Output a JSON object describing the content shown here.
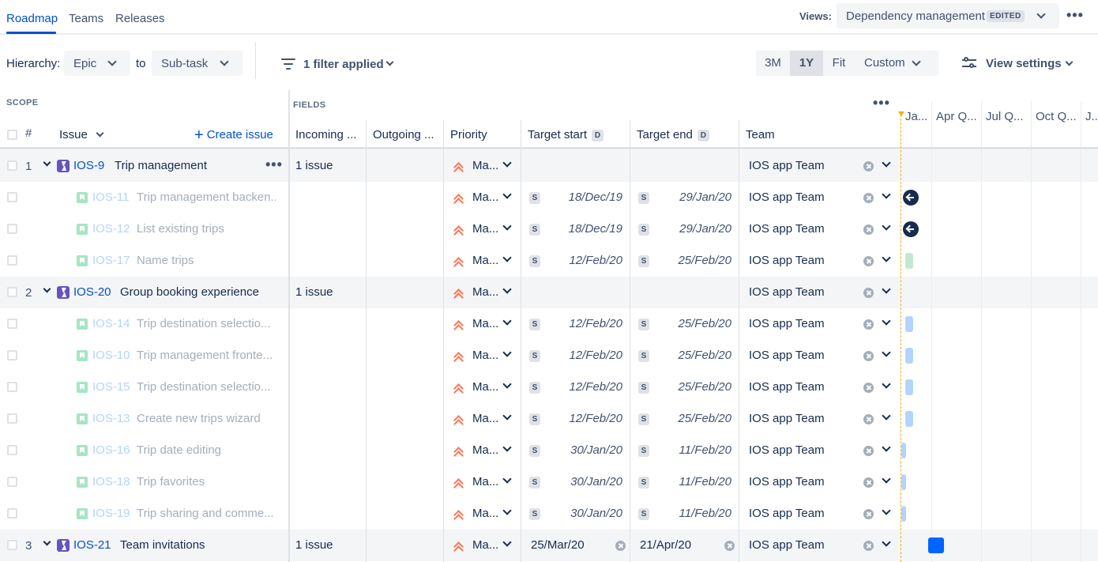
{
  "nav": {
    "tabs": [
      "Roadmap",
      "Teams",
      "Releases"
    ],
    "views_label": "Views:",
    "view_name": "Dependency management",
    "edited_badge": "EDITED"
  },
  "toolbar": {
    "hierarchy_label": "Hierarchy:",
    "hierarchy_from": "Epic",
    "to_label": "to",
    "hierarchy_to": "Sub-task",
    "filter_text": "1 filter applied",
    "ranges": [
      "3M",
      "1Y",
      "Fit",
      "Custom"
    ],
    "active_range": "1Y",
    "view_settings": "View settings"
  },
  "grid": {
    "scope_label": "SCOPE",
    "fields_label": "FIELDS",
    "hash": "#",
    "issue_header": "Issue",
    "create_issue": "Create issue",
    "columns": {
      "incoming": "Incoming ...",
      "outgoing": "Outgoing ...",
      "priority": "Priority",
      "target_start": "Target start",
      "target_end": "Target end",
      "team": "Team",
      "date_badge": "D"
    }
  },
  "timeline": {
    "labels": [
      "Ja...",
      "Apr Q...",
      "Jul Q...",
      "Oct Q...",
      "J..."
    ]
  },
  "rows": [
    {
      "num": "1",
      "type": "epic",
      "key": "IOS-9",
      "summary": "Trip management",
      "incoming": "1 issue",
      "priority": "Ma...",
      "start": "",
      "end": "",
      "team": "IOS app Team"
    },
    {
      "num": "",
      "type": "story",
      "key": "IOS-11",
      "summary": "Trip management backen...",
      "incoming": "",
      "priority": "Ma...",
      "start": "18/Dec/19",
      "end": "29/Jan/20",
      "team": "IOS app Team"
    },
    {
      "num": "",
      "type": "story",
      "key": "IOS-12",
      "summary": "List existing trips",
      "incoming": "",
      "priority": "Ma...",
      "start": "18/Dec/19",
      "end": "29/Jan/20",
      "team": "IOS app Team"
    },
    {
      "num": "",
      "type": "story",
      "key": "IOS-17",
      "summary": "Name trips",
      "incoming": "",
      "priority": "Ma...",
      "start": "12/Feb/20",
      "end": "25/Feb/20",
      "team": "IOS app Team"
    },
    {
      "num": "2",
      "type": "epic",
      "key": "IOS-20",
      "summary": "Group booking experience",
      "incoming": "1 issue",
      "priority": "Ma...",
      "start": "",
      "end": "",
      "team": "IOS app Team"
    },
    {
      "num": "",
      "type": "story",
      "key": "IOS-14",
      "summary": "Trip destination selectio...",
      "incoming": "",
      "priority": "Ma...",
      "start": "12/Feb/20",
      "end": "25/Feb/20",
      "team": "IOS app Team"
    },
    {
      "num": "",
      "type": "story",
      "key": "IOS-10",
      "summary": "Trip management fronte...",
      "incoming": "",
      "priority": "Ma...",
      "start": "12/Feb/20",
      "end": "25/Feb/20",
      "team": "IOS app Team"
    },
    {
      "num": "",
      "type": "story",
      "key": "IOS-15",
      "summary": "Trip destination selectio...",
      "incoming": "",
      "priority": "Ma...",
      "start": "12/Feb/20",
      "end": "25/Feb/20",
      "team": "IOS app Team"
    },
    {
      "num": "",
      "type": "story",
      "key": "IOS-13",
      "summary": "Create new trips wizard",
      "incoming": "",
      "priority": "Ma...",
      "start": "12/Feb/20",
      "end": "25/Feb/20",
      "team": "IOS app Team"
    },
    {
      "num": "",
      "type": "story",
      "key": "IOS-16",
      "summary": "Trip date editing",
      "incoming": "",
      "priority": "Ma...",
      "start": "30/Jan/20",
      "end": "11/Feb/20",
      "team": "IOS app Team"
    },
    {
      "num": "",
      "type": "story",
      "key": "IOS-18",
      "summary": "Trip favorites",
      "incoming": "",
      "priority": "Ma...",
      "start": "30/Jan/20",
      "end": "11/Feb/20",
      "team": "IOS app Team"
    },
    {
      "num": "",
      "type": "story",
      "key": "IOS-19",
      "summary": "Trip sharing and comme...",
      "incoming": "",
      "priority": "Ma...",
      "start": "30/Jan/20",
      "end": "11/Feb/20",
      "team": "IOS app Team"
    },
    {
      "num": "3",
      "type": "epic",
      "key": "IOS-21",
      "summary": "Team invitations",
      "incoming": "1 issue",
      "priority": "Ma...",
      "start": "25/Mar/20",
      "end": "21/Apr/20",
      "team": "IOS app Team"
    }
  ],
  "colors": {
    "accent": "#0052CC",
    "epic": "#6554C0",
    "story": "#A6E5C4",
    "priority": "#FF7452",
    "today": "#FFAB00",
    "bar_light": "#B3D4FF",
    "bar_green": "#C3E8D2",
    "bar_epic": "#0065FF"
  }
}
